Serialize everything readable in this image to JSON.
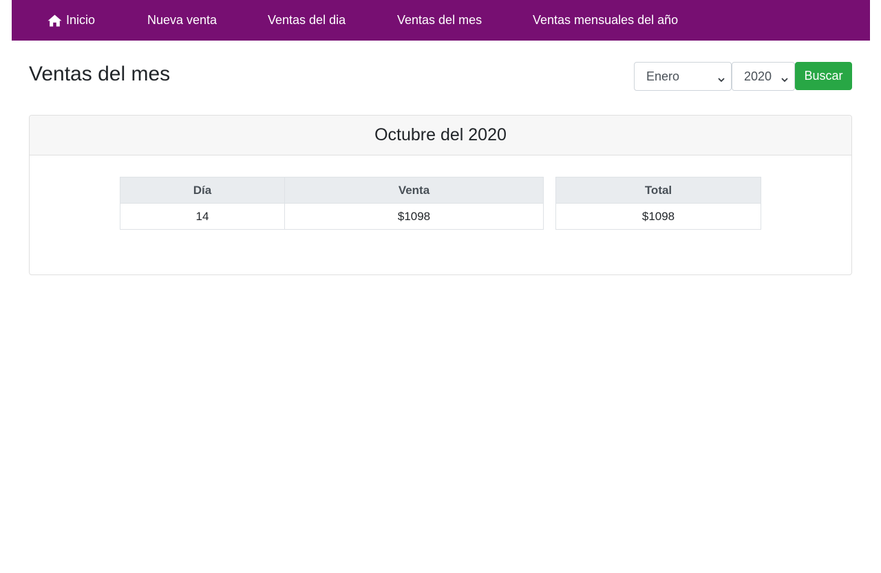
{
  "nav": {
    "items": [
      {
        "label": "Inicio",
        "icon": "home-icon"
      },
      {
        "label": "Nueva venta"
      },
      {
        "label": "Ventas del dia"
      },
      {
        "label": "Ventas del mes"
      },
      {
        "label": "Ventas mensuales del año"
      }
    ]
  },
  "page": {
    "title": "Ventas del mes"
  },
  "filters": {
    "month_selected": "Enero",
    "year_selected": "2020",
    "search_label": "Buscar"
  },
  "card": {
    "header": "Octubre del 2020"
  },
  "sales_table": {
    "headers": [
      "Día",
      "Venta"
    ],
    "rows": [
      {
        "dia": "14",
        "venta": "$1098"
      }
    ]
  },
  "total_table": {
    "header": "Total",
    "value": "$1098"
  },
  "colors": {
    "navbar": "#770f72",
    "search_button": "#28a745"
  }
}
